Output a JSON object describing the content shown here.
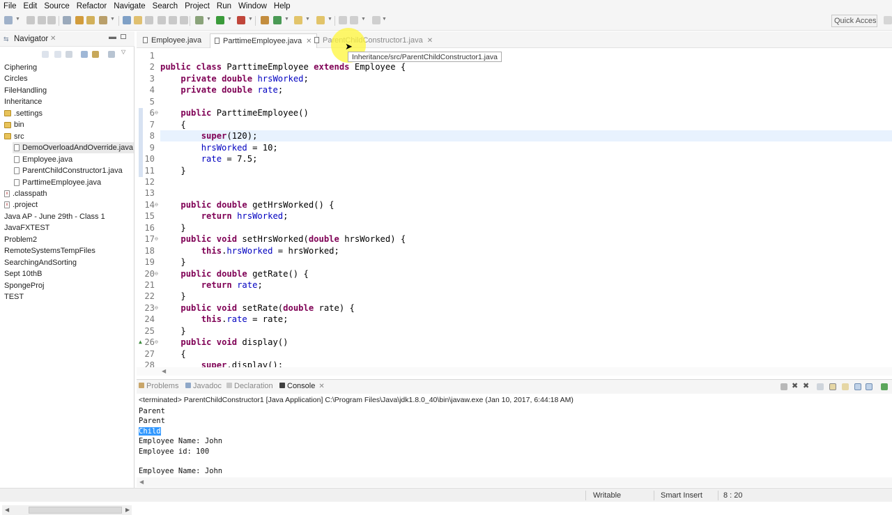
{
  "menu": [
    "File",
    "Edit",
    "Source",
    "Refactor",
    "Navigate",
    "Search",
    "Project",
    "Run",
    "Window",
    "Help"
  ],
  "toolbar": {
    "quick_access": "Quick Access"
  },
  "navigator": {
    "title": "Navigator",
    "items": [
      {
        "label": "Ciphering",
        "icon": "project-icon"
      },
      {
        "label": "Circles",
        "icon": "project-icon"
      },
      {
        "label": "FileHandling",
        "icon": "project-icon"
      },
      {
        "label": "Inheritance",
        "icon": "project-icon"
      },
      {
        "label": ".settings",
        "icon": "folder-icon"
      },
      {
        "label": "bin",
        "icon": "folder-icon"
      },
      {
        "label": "src",
        "icon": "folder-icon"
      },
      {
        "label": "DemoOverloadAndOverride.java",
        "icon": "file-icon"
      },
      {
        "label": "Employee.java",
        "icon": "file-icon"
      },
      {
        "label": "ParentChildConstructor1.java",
        "icon": "file-icon"
      },
      {
        "label": "ParttimeEmployee.java",
        "icon": "file-icon"
      },
      {
        "label": ".classpath",
        "icon": "xml-file-icon"
      },
      {
        "label": ".project",
        "icon": "xml-file-icon"
      },
      {
        "label": "Java AP - June 29th - Class 1",
        "icon": "project-icon"
      },
      {
        "label": "JavaFXTEST",
        "icon": "project-icon"
      },
      {
        "label": "Problem2",
        "icon": "project-icon"
      },
      {
        "label": "RemoteSystemsTempFiles",
        "icon": "project-icon"
      },
      {
        "label": "SearchingAndSorting",
        "icon": "project-icon"
      },
      {
        "label": "Sept 10thB",
        "icon": "project-icon"
      },
      {
        "label": "SpongeProj",
        "icon": "project-icon"
      },
      {
        "label": "TEST",
        "icon": "project-icon"
      }
    ]
  },
  "editor": {
    "tabs": [
      {
        "label": "Employee.java",
        "active": false
      },
      {
        "label": "ParttimeEmployee.java",
        "active": true
      },
      {
        "label": "ParentChildConstructor1.java",
        "active": false
      }
    ],
    "tooltip": "Inheritance/src/ParentChildConstructor1.java",
    "lines": [
      {
        "n": "1",
        "code": ""
      },
      {
        "n": "2",
        "code": "public class ParttimeEmployee extends Employee {"
      },
      {
        "n": "3",
        "code": "    private double hrsWorked;"
      },
      {
        "n": "4",
        "code": "    private double rate;"
      },
      {
        "n": "5",
        "code": ""
      },
      {
        "n": "6",
        "code": "    public ParttimeEmployee()"
      },
      {
        "n": "7",
        "code": "    {"
      },
      {
        "n": "8",
        "code": "        super(120);"
      },
      {
        "n": "9",
        "code": "        hrsWorked = 10;"
      },
      {
        "n": "10",
        "code": "        rate = 7.5;"
      },
      {
        "n": "11",
        "code": "    }"
      },
      {
        "n": "12",
        "code": ""
      },
      {
        "n": "13",
        "code": ""
      },
      {
        "n": "14",
        "code": "    public double getHrsWorked() {"
      },
      {
        "n": "15",
        "code": "        return hrsWorked;"
      },
      {
        "n": "16",
        "code": "    }"
      },
      {
        "n": "17",
        "code": "    public void setHrsWorked(double hrsWorked) {"
      },
      {
        "n": "18",
        "code": "        this.hrsWorked = hrsWorked;"
      },
      {
        "n": "19",
        "code": "    }"
      },
      {
        "n": "20",
        "code": "    public double getRate() {"
      },
      {
        "n": "21",
        "code": "        return rate;"
      },
      {
        "n": "22",
        "code": "    }"
      },
      {
        "n": "23",
        "code": "    public void setRate(double rate) {"
      },
      {
        "n": "24",
        "code": "        this.rate = rate;"
      },
      {
        "n": "25",
        "code": "    }"
      },
      {
        "n": "26",
        "code": "    public void display()"
      },
      {
        "n": "27",
        "code": "    {"
      },
      {
        "n": "28",
        "code": "        super.display();"
      }
    ]
  },
  "console": {
    "tabs": [
      {
        "label": "Problems",
        "active": false
      },
      {
        "label": "Javadoc",
        "active": false
      },
      {
        "label": "Declaration",
        "active": false
      },
      {
        "label": "Console",
        "active": true
      }
    ],
    "status": "<terminated> ParentChildConstructor1 [Java Application] C:\\Program Files\\Java\\jdk1.8.0_40\\bin\\javaw.exe (Jan 10, 2017, 6:44:18 AM)",
    "output": [
      "Parent",
      "Parent",
      "Child",
      "Employee Name: John",
      "Employee id: 100",
      "",
      "Employee Name: John"
    ],
    "selected_line": "Child"
  },
  "statusbar": {
    "writable": "Writable",
    "insert_mode": "Smart Insert",
    "position": "8 : 20"
  },
  "colors": {
    "keyword": "#7f0055",
    "field": "#0000c0",
    "selection": "#3399ff",
    "current_line": "#e8f2fe",
    "cursor_highlight": "#fff63a"
  }
}
